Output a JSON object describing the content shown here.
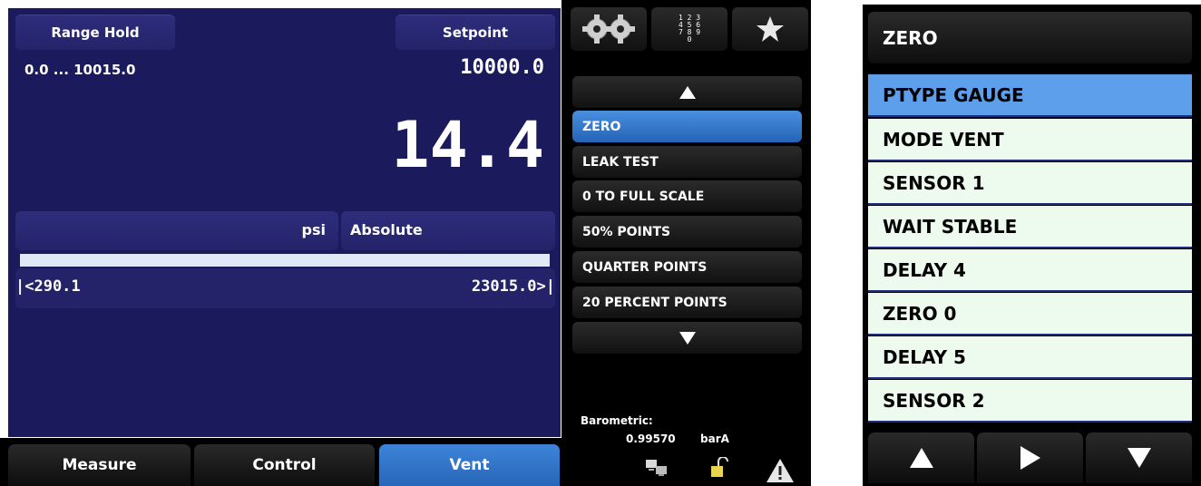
{
  "measure_panel": {
    "range_hold_label": "Range Hold",
    "setpoint_label": "Setpoint",
    "range_text": "0.0 ... 10015.0",
    "setpoint_value": "10000.0",
    "reading": "14.4",
    "unit": "psi",
    "mode": "Absolute",
    "bar_min": "|<290.1",
    "bar_max": "23015.0>|",
    "bar_fill_fraction": 0.0
  },
  "bottom_tabs": [
    {
      "label": "Measure",
      "active": false
    },
    {
      "label": "Control",
      "active": false
    },
    {
      "label": "Vent",
      "active": true
    }
  ],
  "toolbar": {
    "settings_icon": "gears-icon",
    "keypad_icon": "keypad-icon",
    "favorites_icon": "star-icon",
    "keypad_digits": [
      "1 2 3",
      "4 5 6",
      "7 8 9",
      "0"
    ]
  },
  "sequence_menu": {
    "items": [
      "ZERO",
      "LEAK TEST",
      "0 TO FULL SCALE",
      "50% POINTS",
      "QUARTER POINTS",
      "20 PERCENT POINTS"
    ],
    "selected_index": 0
  },
  "status": {
    "barometric_label": "Barometric:",
    "barometric_value": "0.99570",
    "barometric_unit": "barA"
  },
  "step_panel": {
    "title": "ZERO",
    "steps": [
      "PTYPE GAUGE",
      "MODE VENT",
      "SENSOR 1",
      "WAIT STABLE",
      "DELAY 4",
      "ZERO 0",
      "DELAY 5",
      "SENSOR 2"
    ],
    "highlighted_index": 0
  },
  "colors": {
    "panel_navy": "#1b1a5c",
    "accent_blue": "#2866b8",
    "highlight_step": "#5e9fec",
    "step_bg": "#edfbee"
  }
}
